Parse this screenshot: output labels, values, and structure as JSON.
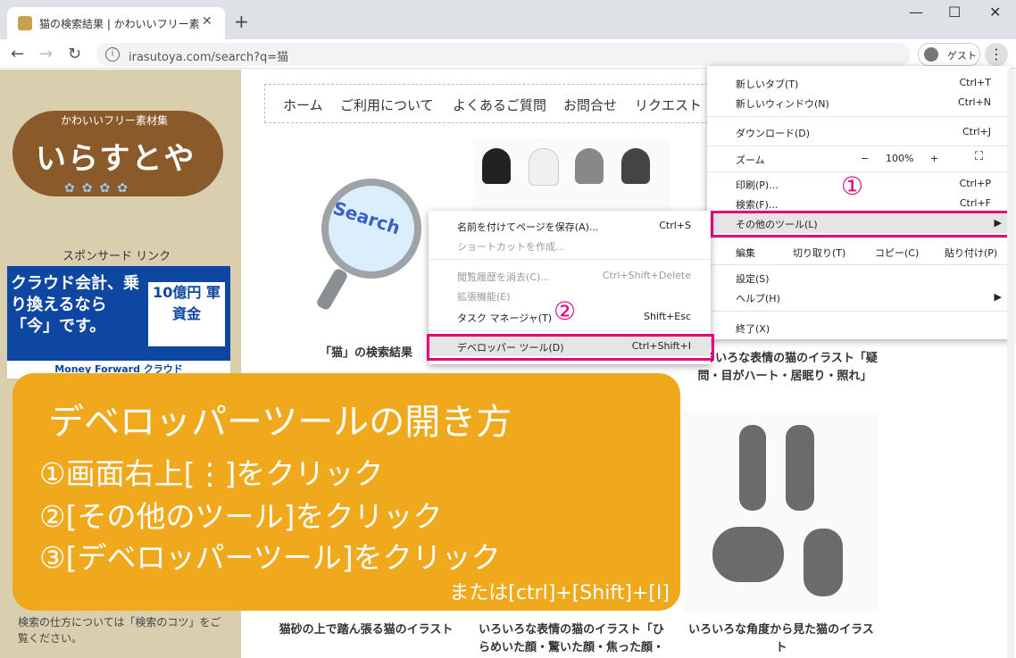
{
  "browser": {
    "tab_title": "猫の検索結果 | かわいいフリー素材集",
    "new_tab": "+",
    "url": "irasutoya.com/search?q=猫",
    "guest_label": "ゲスト",
    "nav_icons": [
      "back-arrow",
      "forward-arrow",
      "reload"
    ],
    "window_controls": [
      "minimize",
      "maximize",
      "close"
    ]
  },
  "site": {
    "logo_small": "かわいいフリー素材集",
    "logo_big": "いらすとや",
    "ad_label": "スポンサード リンク",
    "ad_text": "クラウド会計、乗り換えるなら「今」です。",
    "ad_box_text": "10億円 軍資金",
    "ad_brand": "Money Forward クラウド",
    "help_text": "検索の仕方については「検索のコツ」をご覧ください。",
    "nav": [
      "ホーム",
      "ご利用について",
      "よくあるご質問",
      "お問合せ",
      "リクエスト"
    ],
    "search_word": "Search",
    "search_result_caption": "「猫」の検索結果",
    "item_captions": [
      "いろいろな表情の猫のイラスト「疑問・目がハート・居眠り・照れ」",
      "猫砂の上で踏ん張る猫のイラスト",
      "いろいろな表情の猫のイラスト「ひらめいた顔・驚いた顔・焦った顔・",
      "いろいろな角度から見た猫のイラスト"
    ]
  },
  "chrome_menu": {
    "items": [
      {
        "label": "新しいタブ(T)",
        "shortcut": "Ctrl+T"
      },
      {
        "label": "新しいウィンドウ(N)",
        "shortcut": "Ctrl+N"
      },
      {
        "label": "ダウンロード(D)",
        "shortcut": "Ctrl+J"
      },
      {
        "label": "印刷(P)...",
        "shortcut": "Ctrl+P"
      },
      {
        "label": "検索(F)...",
        "shortcut": "Ctrl+F"
      },
      {
        "label": "その他のツール(L)",
        "shortcut": ""
      },
      {
        "label": "設定(S)",
        "shortcut": ""
      },
      {
        "label": "ヘルプ(H)",
        "shortcut": ""
      },
      {
        "label": "終了(X)",
        "shortcut": ""
      }
    ],
    "zoom": {
      "label": "ズーム",
      "minus": "−",
      "value": "100%",
      "plus": "+"
    },
    "edit": {
      "label": "編集",
      "cut": "切り取り(T)",
      "copy": "コピー(C)",
      "paste": "貼り付け(P)"
    }
  },
  "submenu": {
    "items": [
      {
        "label": "名前を付けてページを保存(A)...",
        "shortcut": "Ctrl+S"
      },
      {
        "label": "ショートカットを作成...",
        "shortcut": ""
      },
      {
        "label": "閲覧履歴を消去(C)...",
        "shortcut": "Ctrl+Shift+Delete"
      },
      {
        "label": "拡張機能(E)",
        "shortcut": ""
      },
      {
        "label": "タスク マネージャ(T)",
        "shortcut": "Shift+Esc"
      },
      {
        "label": "デベロッパー ツール(D)",
        "shortcut": "Ctrl+Shift+I"
      }
    ]
  },
  "annotations": {
    "step1": "①",
    "step2": "②",
    "title": "デベロッパーツールの開き方",
    "steps": [
      "①画面右上[⋮]をクリック",
      "②[その他のツール]をクリック",
      "③[デベロッパーツール]をクリック"
    ],
    "alt": "または[ctrl]+[Shift]+[I]"
  },
  "colors": {
    "highlight": "#e6007e",
    "overlay": "#f0a81d",
    "sidebar": "#d9ceae"
  }
}
